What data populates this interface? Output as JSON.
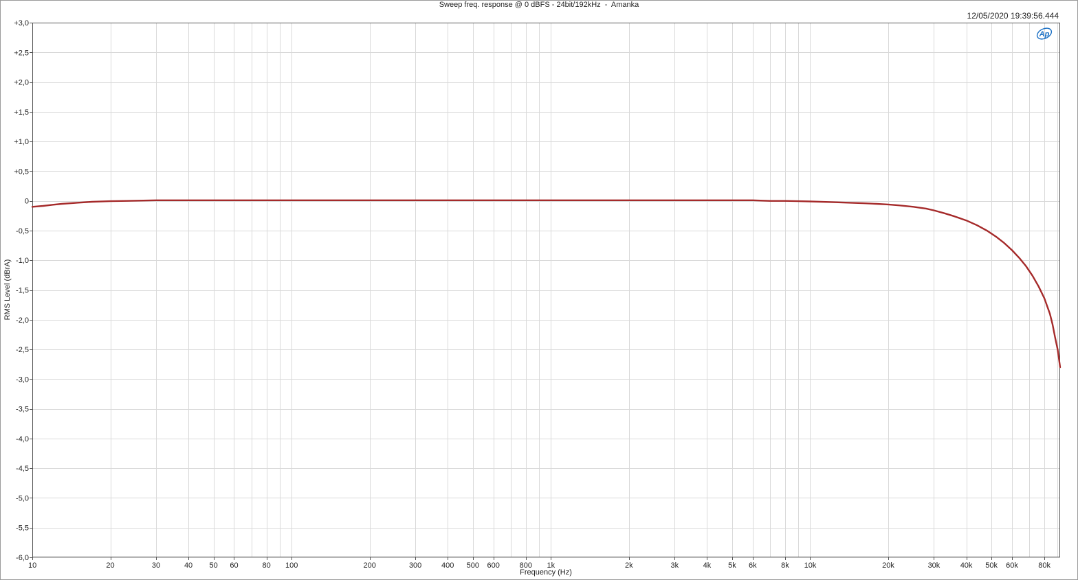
{
  "chart_data": {
    "type": "line",
    "title": "Sweep freq. response @ 0 dBFS - 24bit/192kHz  -  Amanka",
    "timestamp": "12/05/2020 19:39:56.444",
    "xlabel": "Frequency (Hz)",
    "ylabel": "RMS Level (dBrA)",
    "x_scale": "log",
    "xlim": [
      10,
      92000
    ],
    "ylim": [
      -6.0,
      3.0
    ],
    "grid": true,
    "y_ticks": [
      {
        "value": 3.0,
        "label": "+3,0"
      },
      {
        "value": 2.5,
        "label": "+2,5"
      },
      {
        "value": 2.0,
        "label": "+2,0"
      },
      {
        "value": 1.5,
        "label": "+1,5"
      },
      {
        "value": 1.0,
        "label": "+1,0"
      },
      {
        "value": 0.5,
        "label": "+0,5"
      },
      {
        "value": 0.0,
        "label": "0"
      },
      {
        "value": -0.5,
        "label": "-0,5"
      },
      {
        "value": -1.0,
        "label": "-1,0"
      },
      {
        "value": -1.5,
        "label": "-1,5"
      },
      {
        "value": -2.0,
        "label": "-2,0"
      },
      {
        "value": -2.5,
        "label": "-2,5"
      },
      {
        "value": -3.0,
        "label": "-3,0"
      },
      {
        "value": -3.5,
        "label": "-3,5"
      },
      {
        "value": -4.0,
        "label": "-4,0"
      },
      {
        "value": -4.5,
        "label": "-4,5"
      },
      {
        "value": -5.0,
        "label": "-5,0"
      },
      {
        "value": -5.5,
        "label": "-5,5"
      },
      {
        "value": -6.0,
        "label": "-6,0"
      }
    ],
    "x_ticks": [
      {
        "value": 10,
        "label": "10"
      },
      {
        "value": 20,
        "label": "20"
      },
      {
        "value": 30,
        "label": "30"
      },
      {
        "value": 40,
        "label": "40"
      },
      {
        "value": 50,
        "label": "50"
      },
      {
        "value": 60,
        "label": "60"
      },
      {
        "value": 80,
        "label": "80"
      },
      {
        "value": 100,
        "label": "100"
      },
      {
        "value": 200,
        "label": "200"
      },
      {
        "value": 300,
        "label": "300"
      },
      {
        "value": 400,
        "label": "400"
      },
      {
        "value": 500,
        "label": "500"
      },
      {
        "value": 600,
        "label": "600"
      },
      {
        "value": 800,
        "label": "800"
      },
      {
        "value": 1000,
        "label": "1k"
      },
      {
        "value": 2000,
        "label": "2k"
      },
      {
        "value": 3000,
        "label": "3k"
      },
      {
        "value": 4000,
        "label": "4k"
      },
      {
        "value": 5000,
        "label": "5k"
      },
      {
        "value": 6000,
        "label": "6k"
      },
      {
        "value": 8000,
        "label": "8k"
      },
      {
        "value": 10000,
        "label": "10k"
      },
      {
        "value": 20000,
        "label": "20k"
      },
      {
        "value": 30000,
        "label": "30k"
      },
      {
        "value": 40000,
        "label": "40k"
      },
      {
        "value": 50000,
        "label": "50k"
      },
      {
        "value": 60000,
        "label": "60k"
      },
      {
        "value": 80000,
        "label": "80k"
      }
    ],
    "x_gridlines": [
      10,
      20,
      30,
      40,
      50,
      60,
      70,
      80,
      90,
      100,
      200,
      300,
      400,
      500,
      600,
      700,
      800,
      900,
      1000,
      2000,
      3000,
      4000,
      5000,
      6000,
      7000,
      8000,
      9000,
      10000,
      20000,
      30000,
      40000,
      50000,
      60000,
      70000,
      80000,
      90000
    ],
    "series": [
      {
        "color": "#a52a2a",
        "x": [
          10,
          11,
          12,
          13,
          15,
          17,
          20,
          23,
          30,
          50,
          100,
          200,
          500,
          1000,
          2000,
          5000,
          6000,
          7000,
          8000,
          9000,
          10000,
          12000,
          14000,
          16000,
          18000,
          20000,
          22000,
          25000,
          28000,
          30000,
          33000,
          36000,
          40000,
          44000,
          48000,
          52000,
          56000,
          60000,
          64000,
          68000,
          72000,
          76000,
          80000,
          84000,
          86000,
          88000,
          90000,
          92000
        ],
        "y": [
          -0.1,
          -0.085,
          -0.065,
          -0.05,
          -0.03,
          -0.015,
          -0.005,
          0.0,
          0.01,
          0.01,
          0.01,
          0.01,
          0.01,
          0.01,
          0.01,
          0.01,
          0.01,
          0.0,
          0.0,
          -0.005,
          -0.01,
          -0.02,
          -0.03,
          -0.04,
          -0.05,
          -0.06,
          -0.075,
          -0.1,
          -0.13,
          -0.16,
          -0.21,
          -0.26,
          -0.33,
          -0.41,
          -0.5,
          -0.6,
          -0.71,
          -0.83,
          -0.96,
          -1.1,
          -1.26,
          -1.44,
          -1.64,
          -1.9,
          -2.08,
          -2.3,
          -2.5,
          -2.8
        ]
      }
    ]
  },
  "logo_text": "Ap"
}
